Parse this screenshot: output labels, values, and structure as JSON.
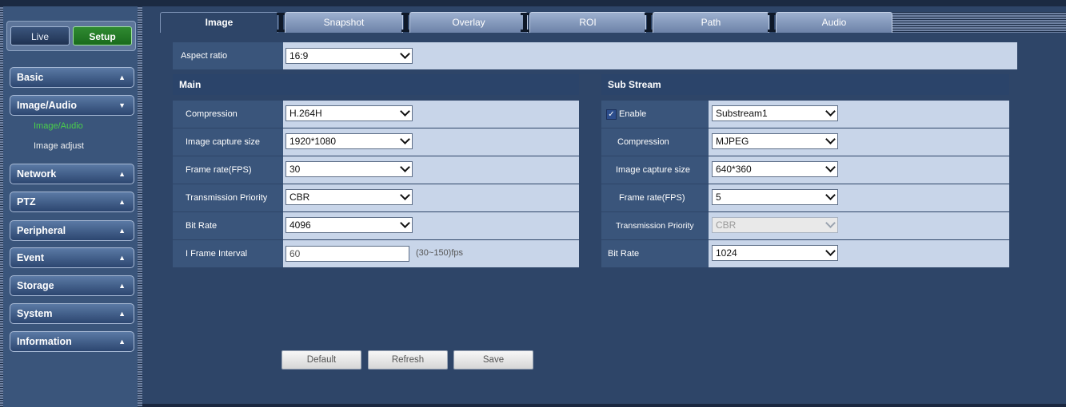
{
  "mode": {
    "live": "Live",
    "setup": "Setup"
  },
  "sidebar": {
    "items": [
      {
        "label": "Basic"
      },
      {
        "label": "Image/Audio"
      },
      {
        "label": "Network"
      },
      {
        "label": "PTZ"
      },
      {
        "label": "Peripheral"
      },
      {
        "label": "Event"
      },
      {
        "label": "Storage"
      },
      {
        "label": "System"
      },
      {
        "label": "Information"
      }
    ],
    "submenu": [
      "Image/Audio",
      "Image adjust"
    ]
  },
  "tabs": [
    "Image",
    "Snapshot",
    "Overlay",
    "ROI",
    "Path",
    "Audio"
  ],
  "aspect": {
    "label": "Aspect ratio",
    "value": "16:9"
  },
  "main": {
    "title": "Main",
    "rows": [
      {
        "label": "Compression",
        "value": "H.264H"
      },
      {
        "label": "Image capture size",
        "value": "1920*1080"
      },
      {
        "label": "Frame rate(FPS)",
        "value": "30"
      },
      {
        "label": "Transmission Priority",
        "value": "CBR"
      },
      {
        "label": "Bit Rate",
        "value": "4096"
      },
      {
        "label": "I Frame Interval",
        "value": "60",
        "hint": "(30~150)fps"
      }
    ]
  },
  "sub": {
    "title": "Sub Stream",
    "enable_label": "Enable",
    "enable_value": "Substream1",
    "rows": [
      {
        "label": "Compression",
        "value": "MJPEG"
      },
      {
        "label": "Image capture size",
        "value": "640*360"
      },
      {
        "label": "Frame rate(FPS)",
        "value": "5"
      },
      {
        "label": "Transmission Priority",
        "value": "CBR"
      },
      {
        "label": "Bit Rate",
        "value": "1024"
      }
    ]
  },
  "buttons": {
    "default": "Default",
    "refresh": "Refresh",
    "save": "Save"
  },
  "colors": {
    "accent_green": "#4ad04a",
    "panel": "#2e4568",
    "field_bg": "#c8d5e9"
  }
}
